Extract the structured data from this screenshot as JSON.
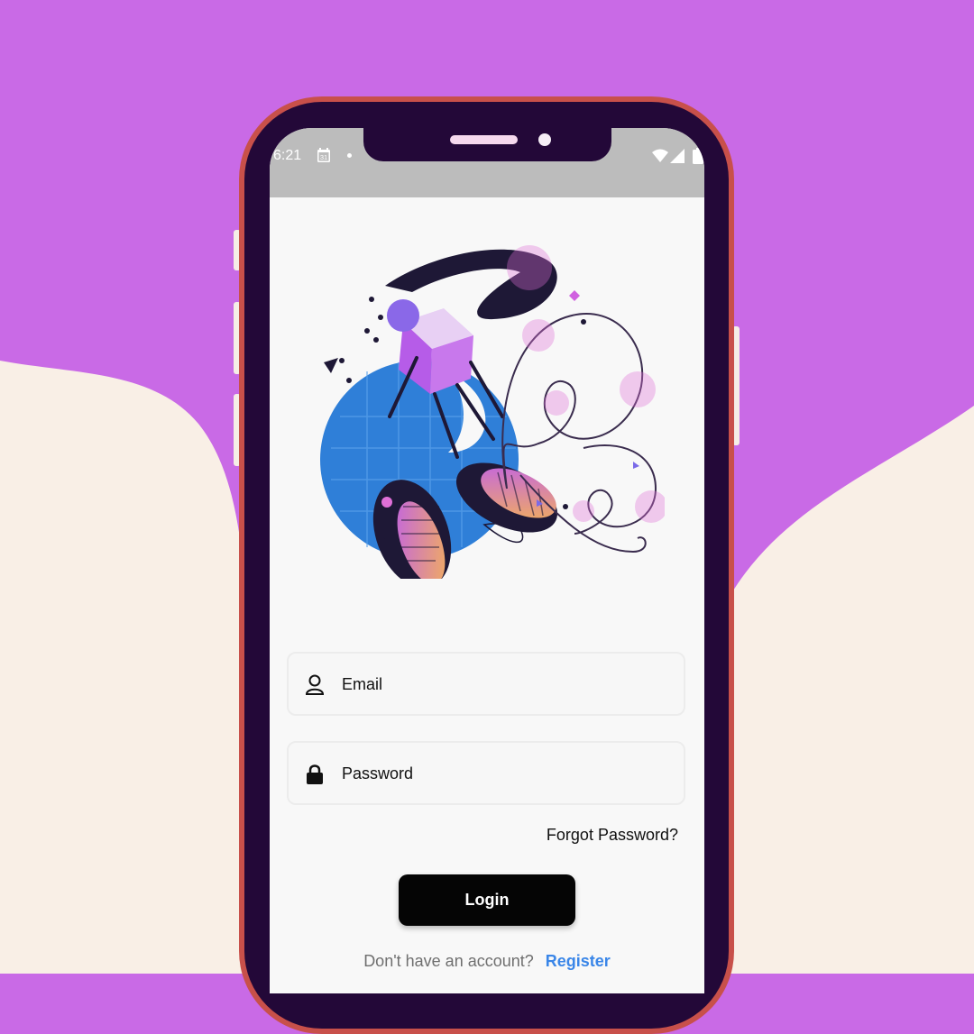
{
  "status_bar": {
    "time": "6:21",
    "calendar_date": "31"
  },
  "illustration": {
    "icon": "abstract-art-illustration"
  },
  "login_form": {
    "email_placeholder": "Email",
    "password_placeholder": "Password",
    "forgot_password": "Forgot Password?",
    "login_button": "Login",
    "no_account_text": "Don't have an account?",
    "register_link": "Register"
  },
  "colors": {
    "background_purple": "#c96ae6",
    "background_cream": "#f9efe6",
    "phone_frame": "#c8504a",
    "phone_bezel": "#230838",
    "button": "#050505",
    "link": "#3a86e8"
  }
}
